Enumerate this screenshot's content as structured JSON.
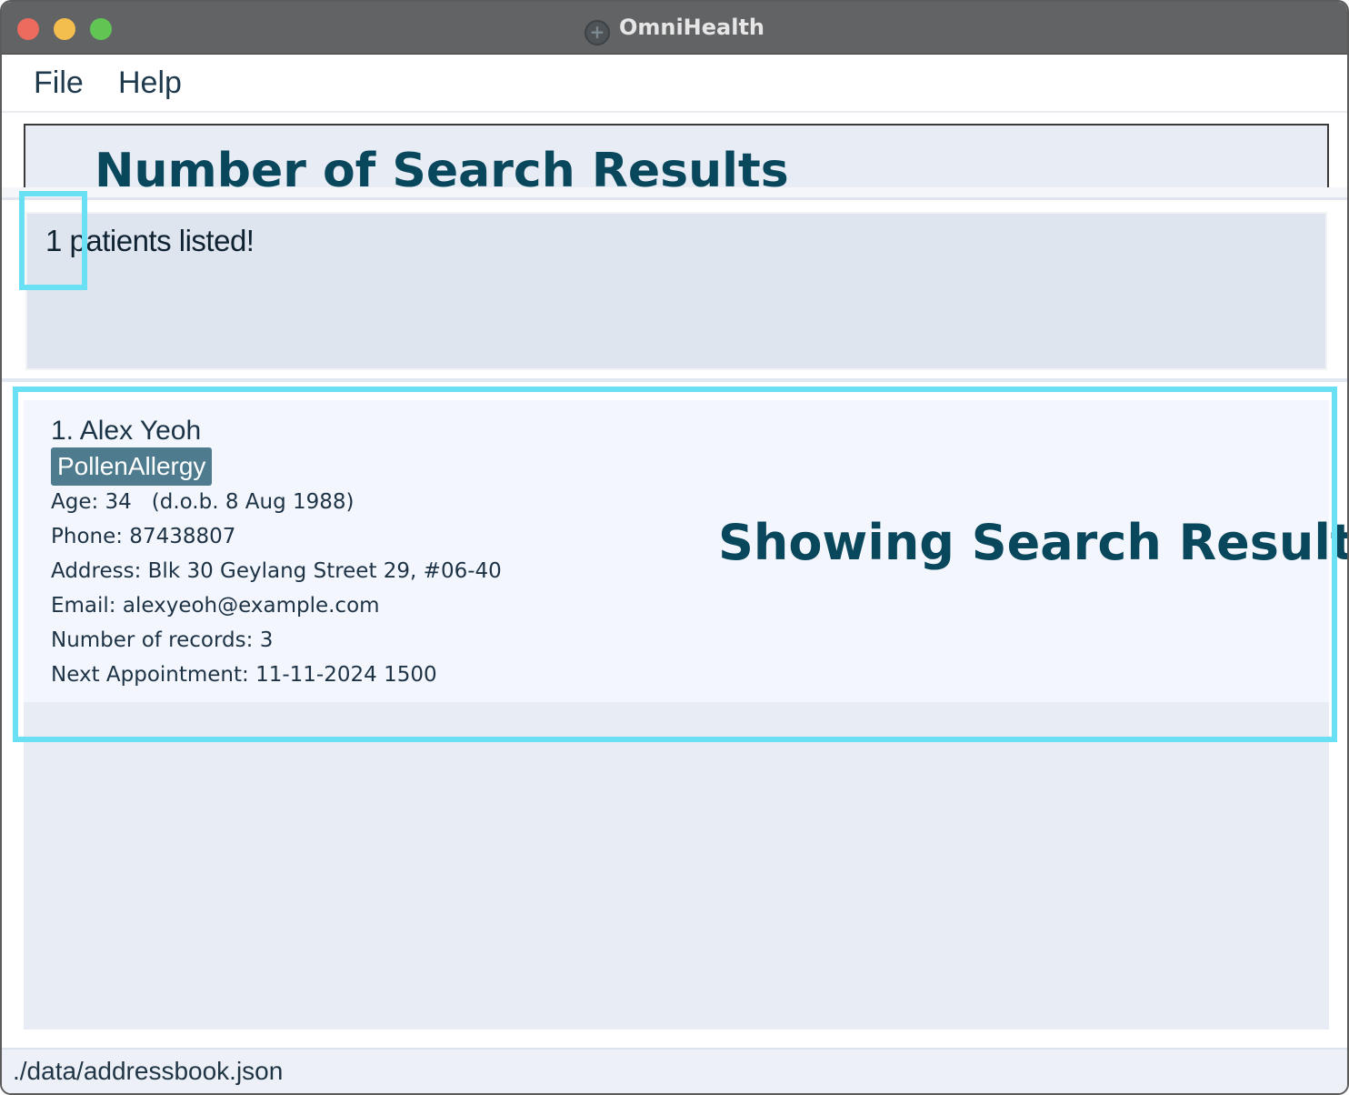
{
  "window": {
    "title": "OmniHealth"
  },
  "menu": {
    "items": [
      "File",
      "Help"
    ]
  },
  "result_display": {
    "text": "1 patients listed!"
  },
  "patients": [
    {
      "index": "1.",
      "name": "Alex Yeoh",
      "tags": [
        "PollenAllergy"
      ],
      "age": "Age: 34   (d.o.b. 8 Aug 1988)",
      "phone": "Phone: 87438807",
      "address": "Address: Blk 30 Geylang Street 29, #06-40",
      "email": "Email: alexyeoh@example.com",
      "records": "Number of records: 3",
      "next_appointment": "Next Appointment: 11-11-2024 1500"
    }
  ],
  "annotations": {
    "number_of_results": "Number of Search Results",
    "showing_results": "Showing Search Results",
    "highlight_color": "#6ae0f5",
    "text_color": "#09475c"
  },
  "status_bar": {
    "path": "./data/addressbook.json"
  }
}
